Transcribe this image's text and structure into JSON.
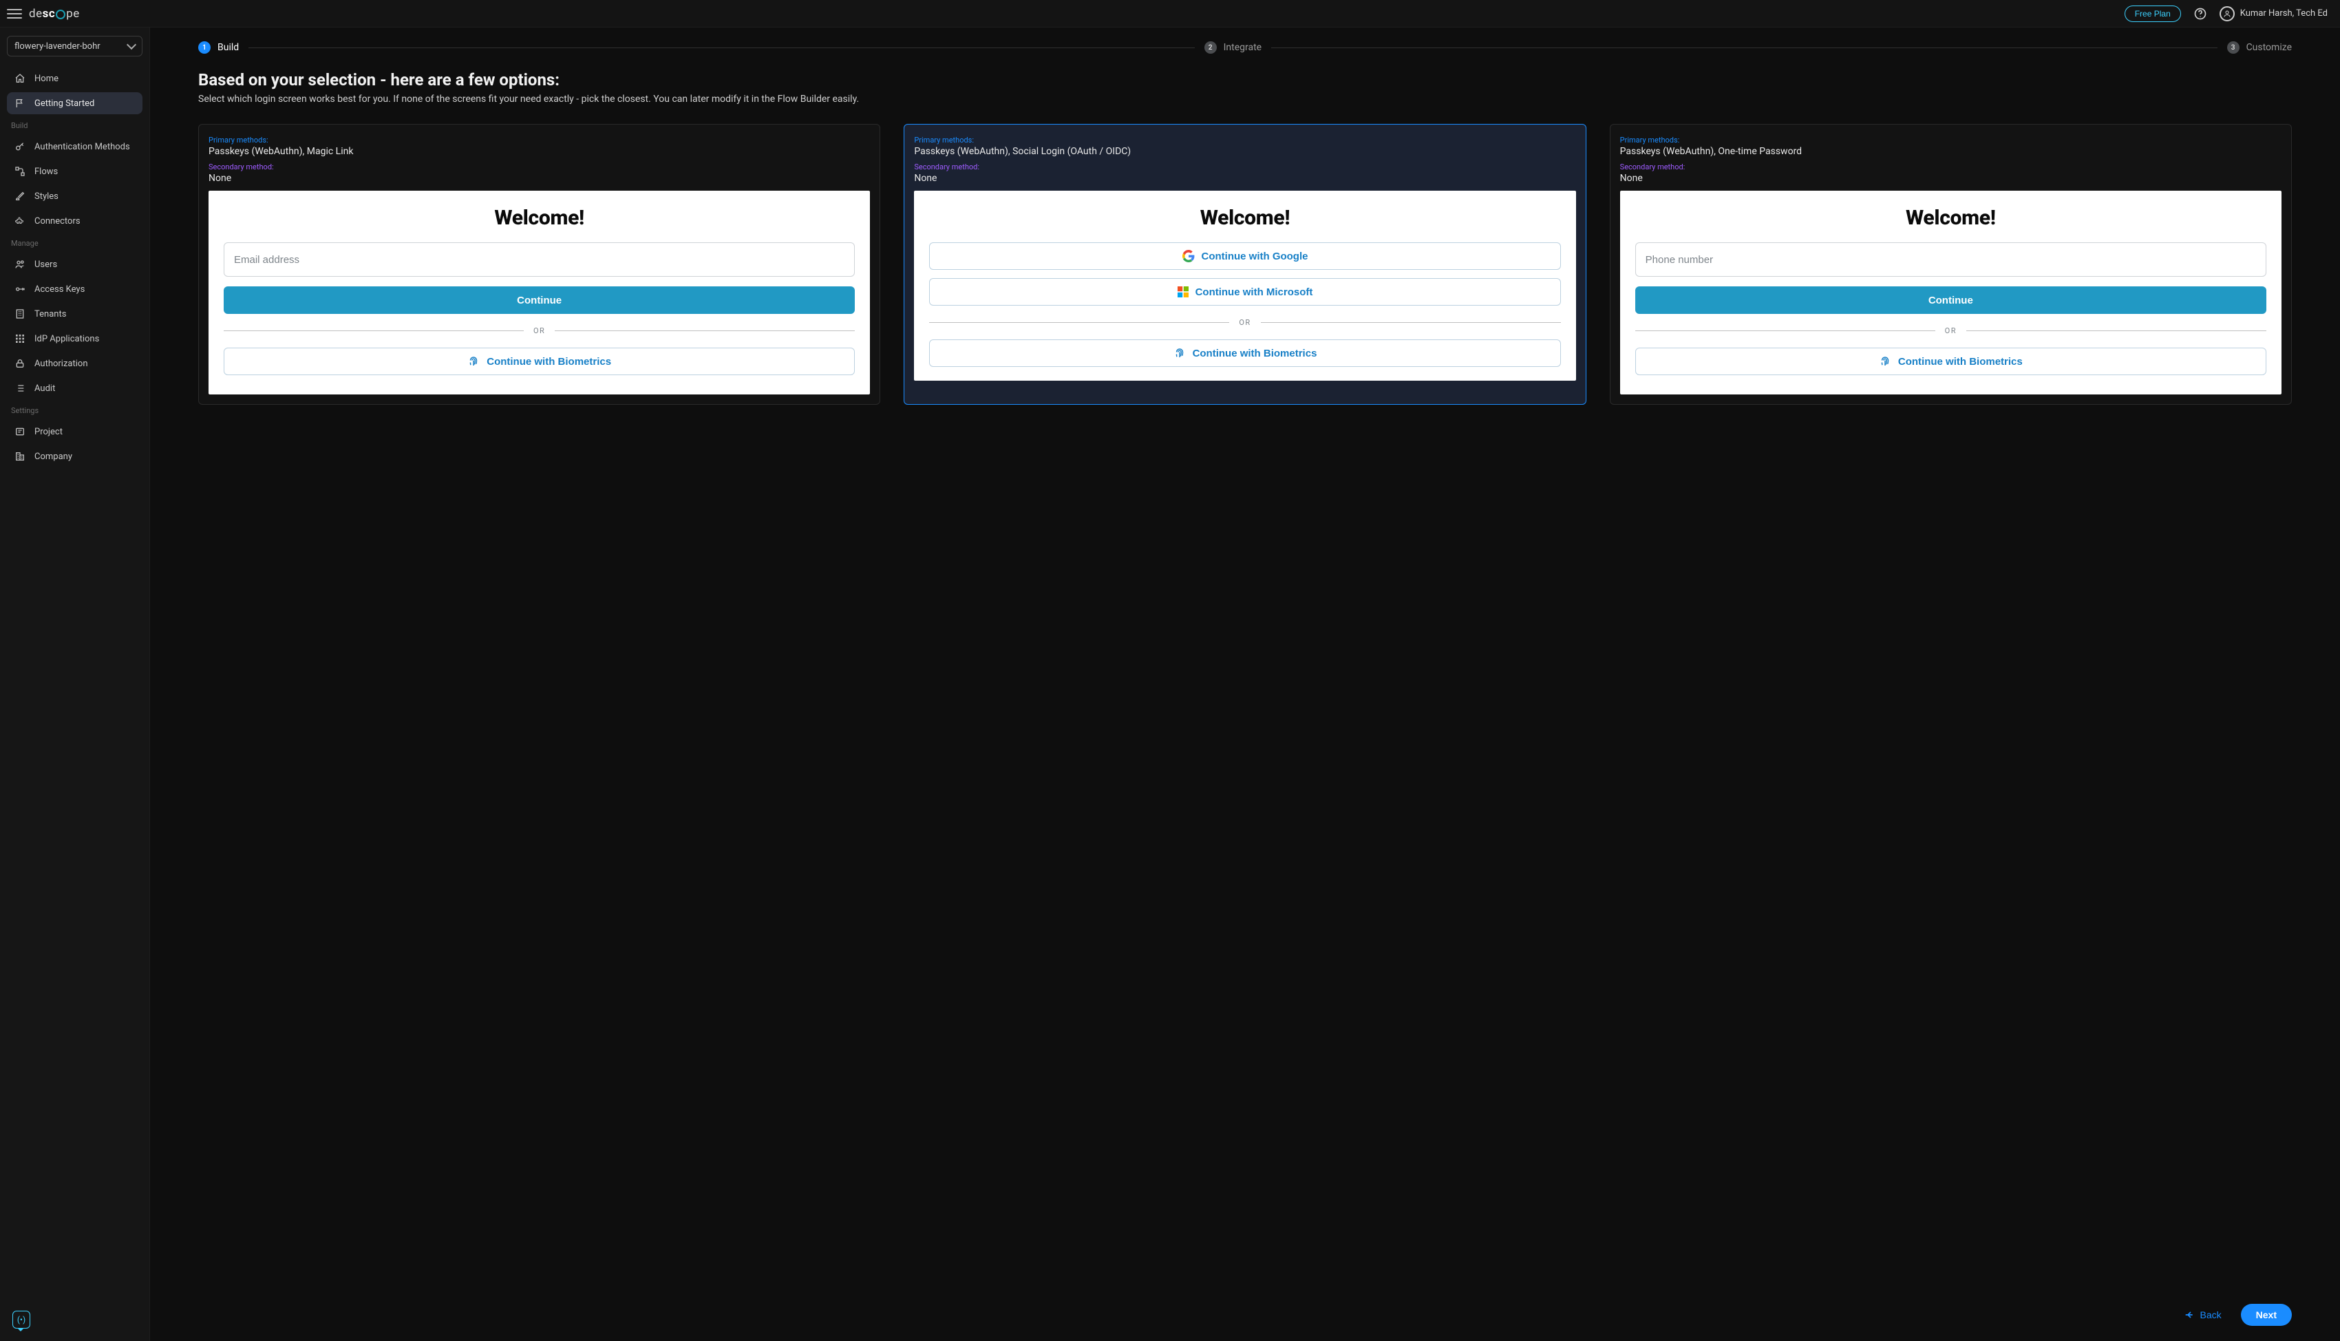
{
  "header": {
    "free_plan": "Free Plan",
    "user_name": "Kumar Harsh, Tech Ed"
  },
  "project_name": "flowery-lavender-bohr",
  "sidebar": {
    "items_top": [
      {
        "label": "Home"
      },
      {
        "label": "Getting Started"
      }
    ],
    "section_build": "Build",
    "items_build": [
      {
        "label": "Authentication Methods"
      },
      {
        "label": "Flows"
      },
      {
        "label": "Styles"
      },
      {
        "label": "Connectors"
      }
    ],
    "section_manage": "Manage",
    "items_manage": [
      {
        "label": "Users"
      },
      {
        "label": "Access Keys"
      },
      {
        "label": "Tenants"
      },
      {
        "label": "IdP Applications"
      },
      {
        "label": "Authorization"
      },
      {
        "label": "Audit"
      }
    ],
    "section_settings": "Settings",
    "items_settings": [
      {
        "label": "Project"
      },
      {
        "label": "Company"
      }
    ]
  },
  "stepper": {
    "step1_num": "1",
    "step1_label": "Build",
    "step2_num": "2",
    "step2_label": "Integrate",
    "step3_num": "3",
    "step3_label": "Customize"
  },
  "page": {
    "title": "Based on your selection - here are a few options:",
    "subtitle": "Select which login screen works best for you. If none of the screens fit your need exactly - pick the closest. You can later modify it in the Flow Builder easily."
  },
  "meta_labels": {
    "primary": "Primary methods:",
    "secondary": "Secondary method:"
  },
  "common": {
    "welcome": "Welcome!",
    "or": "OR",
    "continue": "Continue",
    "biometrics": "Continue with Biometrics",
    "google": "Continue with Google",
    "microsoft": "Continue with Microsoft",
    "email_ph": "Email address",
    "phone_ph": "Phone number"
  },
  "cards": {
    "c1": {
      "primary": "Passkeys (WebAuthn), Magic Link",
      "secondary": "None"
    },
    "c2": {
      "primary": "Passkeys (WebAuthn), Social Login (OAuth / OIDC)",
      "secondary": "None"
    },
    "c3": {
      "primary": "Passkeys (WebAuthn), One-time Password",
      "secondary": "None"
    }
  },
  "footer": {
    "back": "Back",
    "next": "Next"
  }
}
